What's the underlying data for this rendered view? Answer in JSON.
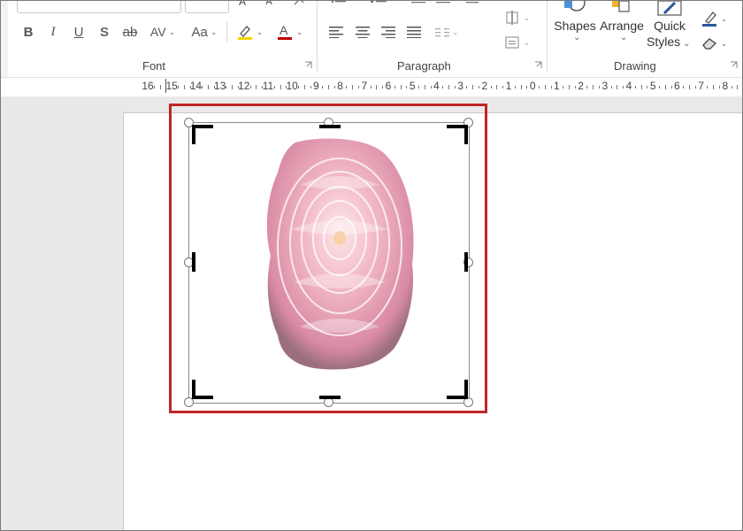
{
  "ribbon": {
    "groups": {
      "font": {
        "label": "Font"
      },
      "paragraph": {
        "label": "Paragraph"
      },
      "drawing": {
        "label": "Drawing"
      }
    },
    "font_buttons": {
      "bold": "B",
      "italic": "I",
      "underline": "U",
      "shadow": "S",
      "strikethrough": "ab",
      "spacing": "AV",
      "change_case": "Aa"
    },
    "drawing_buttons": {
      "shapes": "Shapes",
      "arrange": "Arrange",
      "quick_styles_line1": "Quick",
      "quick_styles_line2": "Styles"
    },
    "colors": {
      "highlight": "#f2d600",
      "font_color": "#c00000",
      "shape_outline": "#2b579a"
    }
  },
  "ruler": {
    "labels": [
      "16",
      "15",
      "14",
      "13",
      "12",
      "11",
      "10",
      "9",
      "8",
      "7",
      "6",
      "5",
      "4",
      "3",
      "2",
      "1",
      "0",
      "1",
      "2",
      "3",
      "4",
      "5",
      "6",
      "7",
      "8"
    ]
  },
  "picture": {
    "description_icon": "camellia-image",
    "selection_color": "#c0262b"
  }
}
